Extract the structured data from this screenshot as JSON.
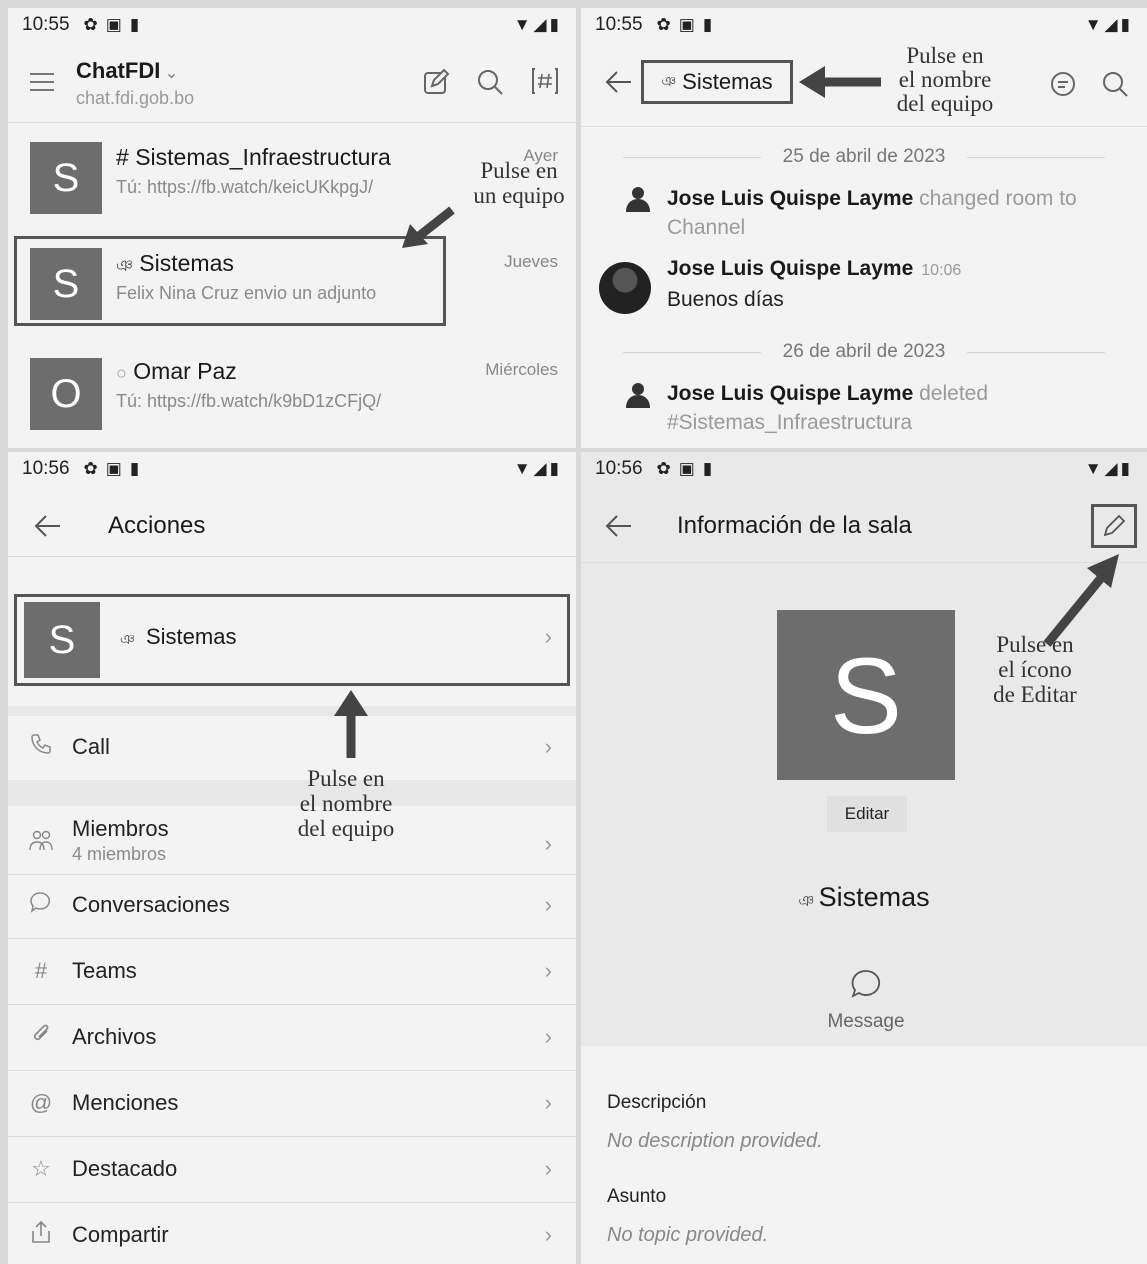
{
  "panels": {
    "room_list": {
      "status": {
        "time": "10:55"
      },
      "header": {
        "title": "ChatFDI",
        "server": "chat.fdi.gob.bo"
      },
      "rooms": [
        {
          "initial": "S",
          "prefix": "#",
          "name": "Sistemas_Infraestructura",
          "last": "Tú: https://fb.watch/keicUKkpgJ/",
          "date": "Ayer"
        },
        {
          "initial": "S",
          "prefix": "ༀ",
          "name": "Sistemas",
          "last": "Felix Nina Cruz envio un adjunto",
          "date": "Jueves"
        },
        {
          "initial": "O",
          "prefix": "○",
          "name": "Omar Paz",
          "last": "Tú: https://fb.watch/k9bD1zCFjQ/",
          "date": "Miércoles"
        }
      ],
      "annotation": {
        "line1": "Pulse en",
        "line2": "un equipo"
      }
    },
    "room_chat": {
      "status": {
        "time": "10:55"
      },
      "header": {
        "room_name": "Sistemas"
      },
      "annotation": {
        "line1": "Pulse en",
        "line2": "el nombre",
        "line3": "del equipo"
      },
      "date1": "25 de abril de 2023",
      "msg1": {
        "author": "Jose Luis Quispe Layme",
        "text": "changed room to Channel"
      },
      "msg2": {
        "author": "Jose Luis Quispe Layme",
        "time": "10:06",
        "text": "Buenos días"
      },
      "date2": "26 de abril de 2023",
      "msg3": {
        "author": "Jose Luis Quispe Layme",
        "text": "deleted #Sistemas_Infraestructura"
      }
    },
    "actions": {
      "status": {
        "time": "10:56"
      },
      "header": {
        "title": "Acciones"
      },
      "room": {
        "initial": "S",
        "name": "Sistemas"
      },
      "annotation": {
        "line1": "Pulse en",
        "line2": "el nombre",
        "line3": "del equipo"
      },
      "items": [
        {
          "label": "Call"
        },
        {
          "label": "Miembros",
          "sub": "4 miembros"
        },
        {
          "label": "Conversaciones"
        },
        {
          "label": "Teams"
        },
        {
          "label": "Archivos"
        },
        {
          "label": "Menciones"
        },
        {
          "label": "Destacado"
        },
        {
          "label": "Compartir"
        }
      ]
    },
    "room_info": {
      "status": {
        "time": "10:56"
      },
      "header": {
        "title": "Información de la sala"
      },
      "avatar_initial": "S",
      "edit_label": "Editar",
      "room_name": "Sistemas",
      "message_label": "Message",
      "annotation": {
        "line1": "Pulse en",
        "line2": "el ícono",
        "line3": "de Editar"
      },
      "description_label": "Descripción",
      "description_value": "No description provided.",
      "topic_label": "Asunto",
      "topic_value": "No topic provided."
    }
  },
  "colors": {
    "avatar": "#6d6d6d",
    "callout": "#555555",
    "background": "#f3f3f3"
  }
}
